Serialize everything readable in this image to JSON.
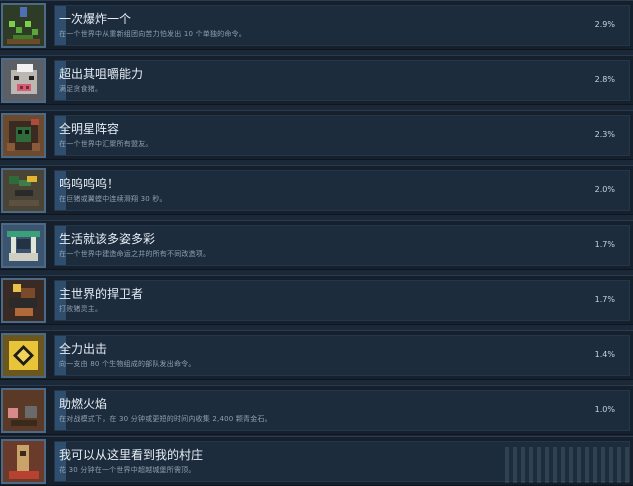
{
  "achievements": [
    {
      "title": "一次爆炸一个",
      "desc": "在一个世界中从重新组团向苦力怕发出 10 个单独的命令。",
      "pct": "2.9%",
      "icon": "creeper-icon"
    },
    {
      "title": "超出其咀嚼能力",
      "desc": "满足贪食猪。",
      "pct": "2.8%",
      "icon": "pig-face-icon"
    },
    {
      "title": "全明星阵容",
      "desc": "在一个世界中汇聚所有盟友。",
      "pct": "2.3%",
      "icon": "allies-icon"
    },
    {
      "title": "呜呜呜呜！",
      "desc": "在巨猪或翼螳中连续滑翔 30 秒。",
      "pct": "2.0%",
      "icon": "glider-icon"
    },
    {
      "title": "生活就该多姿多彩",
      "desc": "在一个世界中建造命运之井的所有不同改造项。",
      "pct": "1.7%",
      "icon": "well-icon"
    },
    {
      "title": "主世界的捍卫者",
      "desc": "打败猪灵主。",
      "pct": "1.7%",
      "icon": "defender-icon"
    },
    {
      "title": "全力出击",
      "desc": "向一支由 80 个生物组成的部队发出命令。",
      "pct": "1.4%",
      "icon": "charge-icon"
    },
    {
      "title": "助燃火焰",
      "desc": "在对战模式下，在 30 分钟或更短的时间内收集 2,400 颗青金石。",
      "pct": "1.0%",
      "icon": "fire-icon"
    },
    {
      "title": "我可以从这里看到我的村庄",
      "desc": "花 30 分钟在一个世界中超越城堡所需顶。",
      "pct": "",
      "icon": "tower-icon"
    }
  ]
}
